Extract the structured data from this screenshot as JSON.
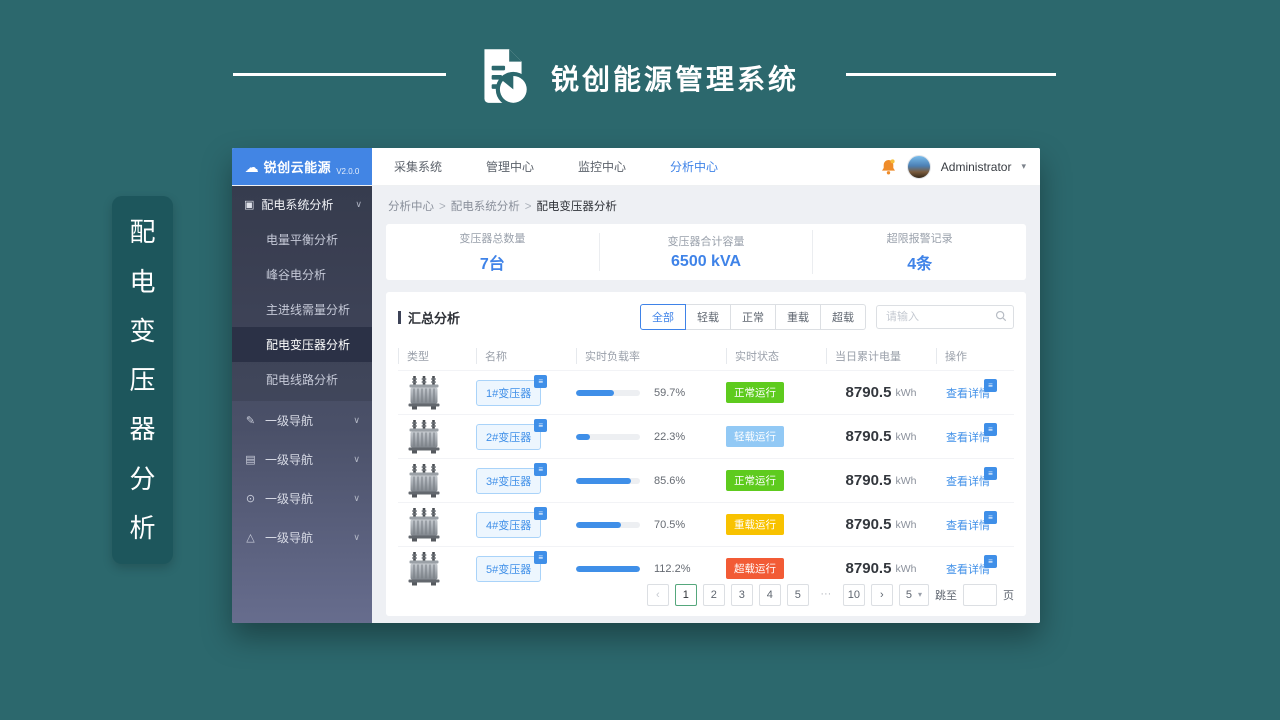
{
  "banner": {
    "title": "锐创能源管理系统",
    "side_vertical_chars": [
      "配",
      "电",
      "变",
      "压",
      "器",
      "分",
      "析"
    ]
  },
  "colors": {
    "page_background": "#2c686d",
    "side_banner": "#1d565c",
    "logo_blue": "#4285e4",
    "accent_blue": "#3f8fe8",
    "status_normal_green": "#5ecb1e",
    "status_light_blue": "#92c9f5",
    "status_heavy_yellow": "#f8c200",
    "status_over_red": "#f25b35",
    "pagination_active_border": "#55a77c"
  },
  "icons": {
    "cloud": "☁",
    "grid": "▣",
    "pencil": "✎",
    "list": "▤",
    "check": "⊙",
    "warning": "△",
    "chevron_down": "∨",
    "caret_down": "▾",
    "chevron_left": "‹",
    "chevron_right": "›",
    "badge_glyph": "≡"
  },
  "app": {
    "logo": {
      "name": "锐创云能源",
      "version": "V2.0.0"
    },
    "topnav": [
      {
        "label": "采集系统"
      },
      {
        "label": "管理中心"
      },
      {
        "label": "监控中心"
      },
      {
        "label": "分析中心"
      }
    ],
    "user": {
      "name": "Administrator"
    },
    "sidebar": {
      "group_title": "配电系统分析",
      "sub_items": [
        {
          "label": "电量平衡分析"
        },
        {
          "label": "峰谷电分析"
        },
        {
          "label": "主进线需量分析"
        },
        {
          "label": "配电变压器分析"
        },
        {
          "label": "配电线路分析"
        }
      ],
      "secondary": [
        {
          "label": "一级导航"
        },
        {
          "label": "一级导航"
        },
        {
          "label": "一级导航"
        },
        {
          "label": "一级导航"
        }
      ]
    },
    "breadcrumb": {
      "l1": "分析中心",
      "l2": "配电系统分析",
      "l3": "配电变压器分析"
    },
    "stats": [
      {
        "label": "变压器总数量",
        "value": "7台"
      },
      {
        "label": "变压器合计容量",
        "value": "6500 kVA"
      },
      {
        "label": "超限报警记录",
        "value": "4条"
      }
    ],
    "summary": {
      "title": "汇总分析",
      "filters": [
        "全部",
        "轻载",
        "正常",
        "重载",
        "超载"
      ],
      "search_placeholder": "请输入",
      "table": {
        "headers": [
          "类型",
          "名称",
          "实时负载率",
          "实时状态",
          "当日累计电量",
          "操作"
        ],
        "unit": "kWh",
        "action_label": "查看详情",
        "rows": [
          {
            "name": "1#变压器",
            "load_pct": 59.7,
            "load_label": "59.7%",
            "status": "正常运行",
            "status_key": "normal",
            "energy": "8790.5"
          },
          {
            "name": "2#变压器",
            "load_pct": 22.3,
            "load_label": "22.3%",
            "status": "轻载运行",
            "status_key": "light",
            "energy": "8790.5"
          },
          {
            "name": "3#变压器",
            "load_pct": 85.6,
            "load_label": "85.6%",
            "status": "正常运行",
            "status_key": "normal",
            "energy": "8790.5"
          },
          {
            "name": "4#变压器",
            "load_pct": 70.5,
            "load_label": "70.5%",
            "status": "重载运行",
            "status_key": "heavy",
            "energy": "8790.5"
          },
          {
            "name": "5#变压器",
            "load_pct": 112.2,
            "load_label": "112.2%",
            "status": "超载运行",
            "status_key": "over",
            "energy": "8790.5"
          }
        ]
      },
      "pagination": {
        "pages": [
          "1",
          "2",
          "3",
          "4",
          "5",
          "···",
          "10"
        ],
        "active_page": "1",
        "page_size": "5",
        "jump_label": "跳至",
        "page_unit_label": "页"
      }
    }
  }
}
